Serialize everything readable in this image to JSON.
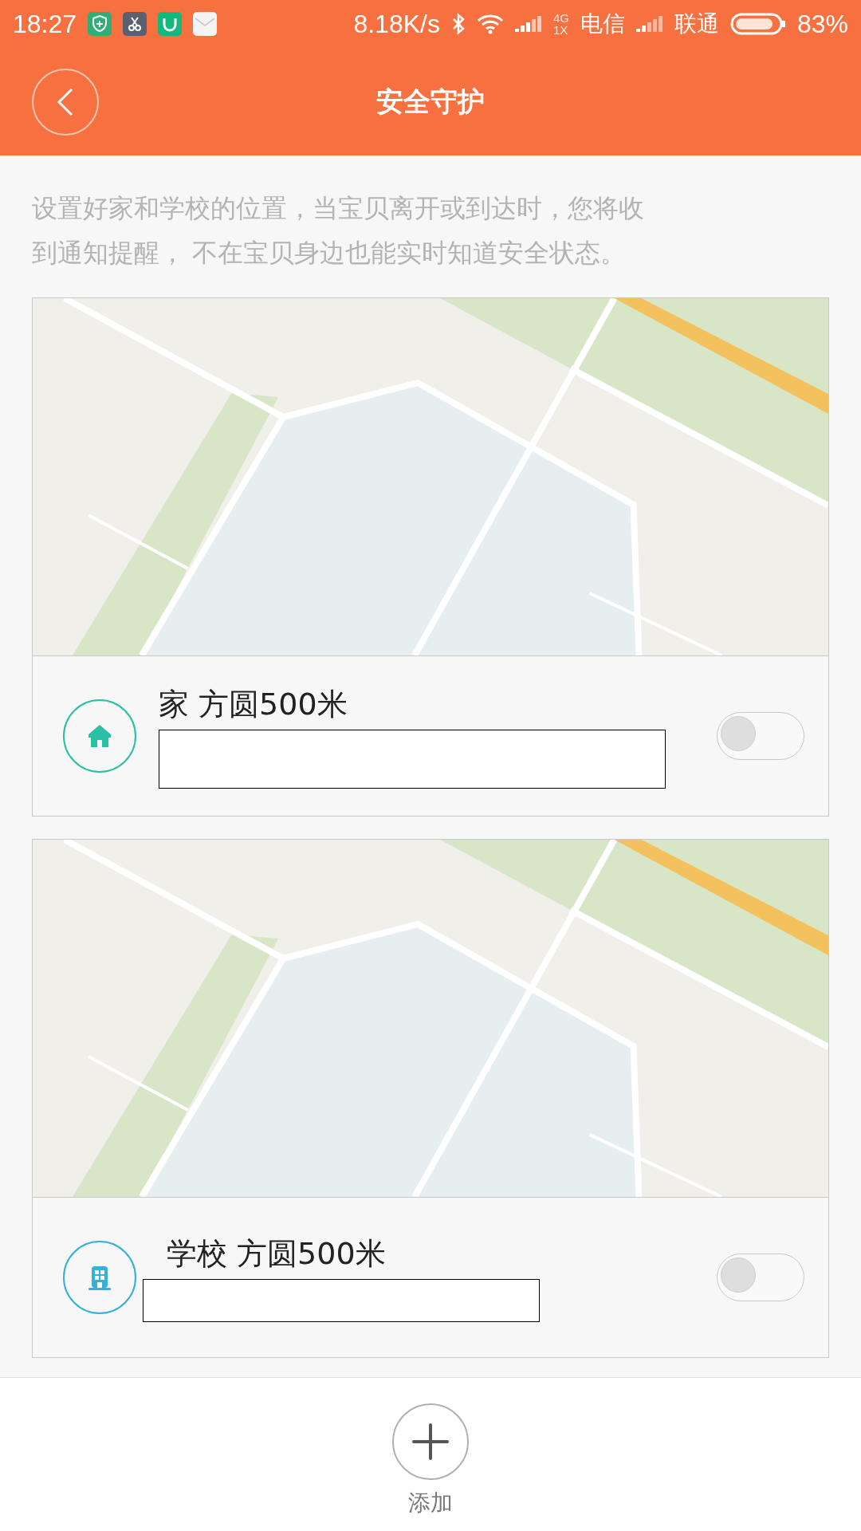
{
  "status_bar": {
    "time": "18:27",
    "speed": "8.18K/s",
    "network_top": "4G",
    "network_bottom": "1X",
    "carrier_1": "电信",
    "carrier_2": "联通",
    "battery": "83%"
  },
  "header": {
    "title": "安全守护"
  },
  "description": "设置好家和学校的位置，当宝贝离开或到达时，您将收到通知提醒， 不在宝贝身边也能实时知道安全状态。",
  "zones": [
    {
      "kind": "home",
      "name": "家 方圆500米",
      "color": "#2bbfa4",
      "on": false
    },
    {
      "kind": "school",
      "name": "学校 方圆500米",
      "color": "#34b0d9",
      "on": false
    }
  ],
  "add_button": {
    "label": "添加"
  }
}
